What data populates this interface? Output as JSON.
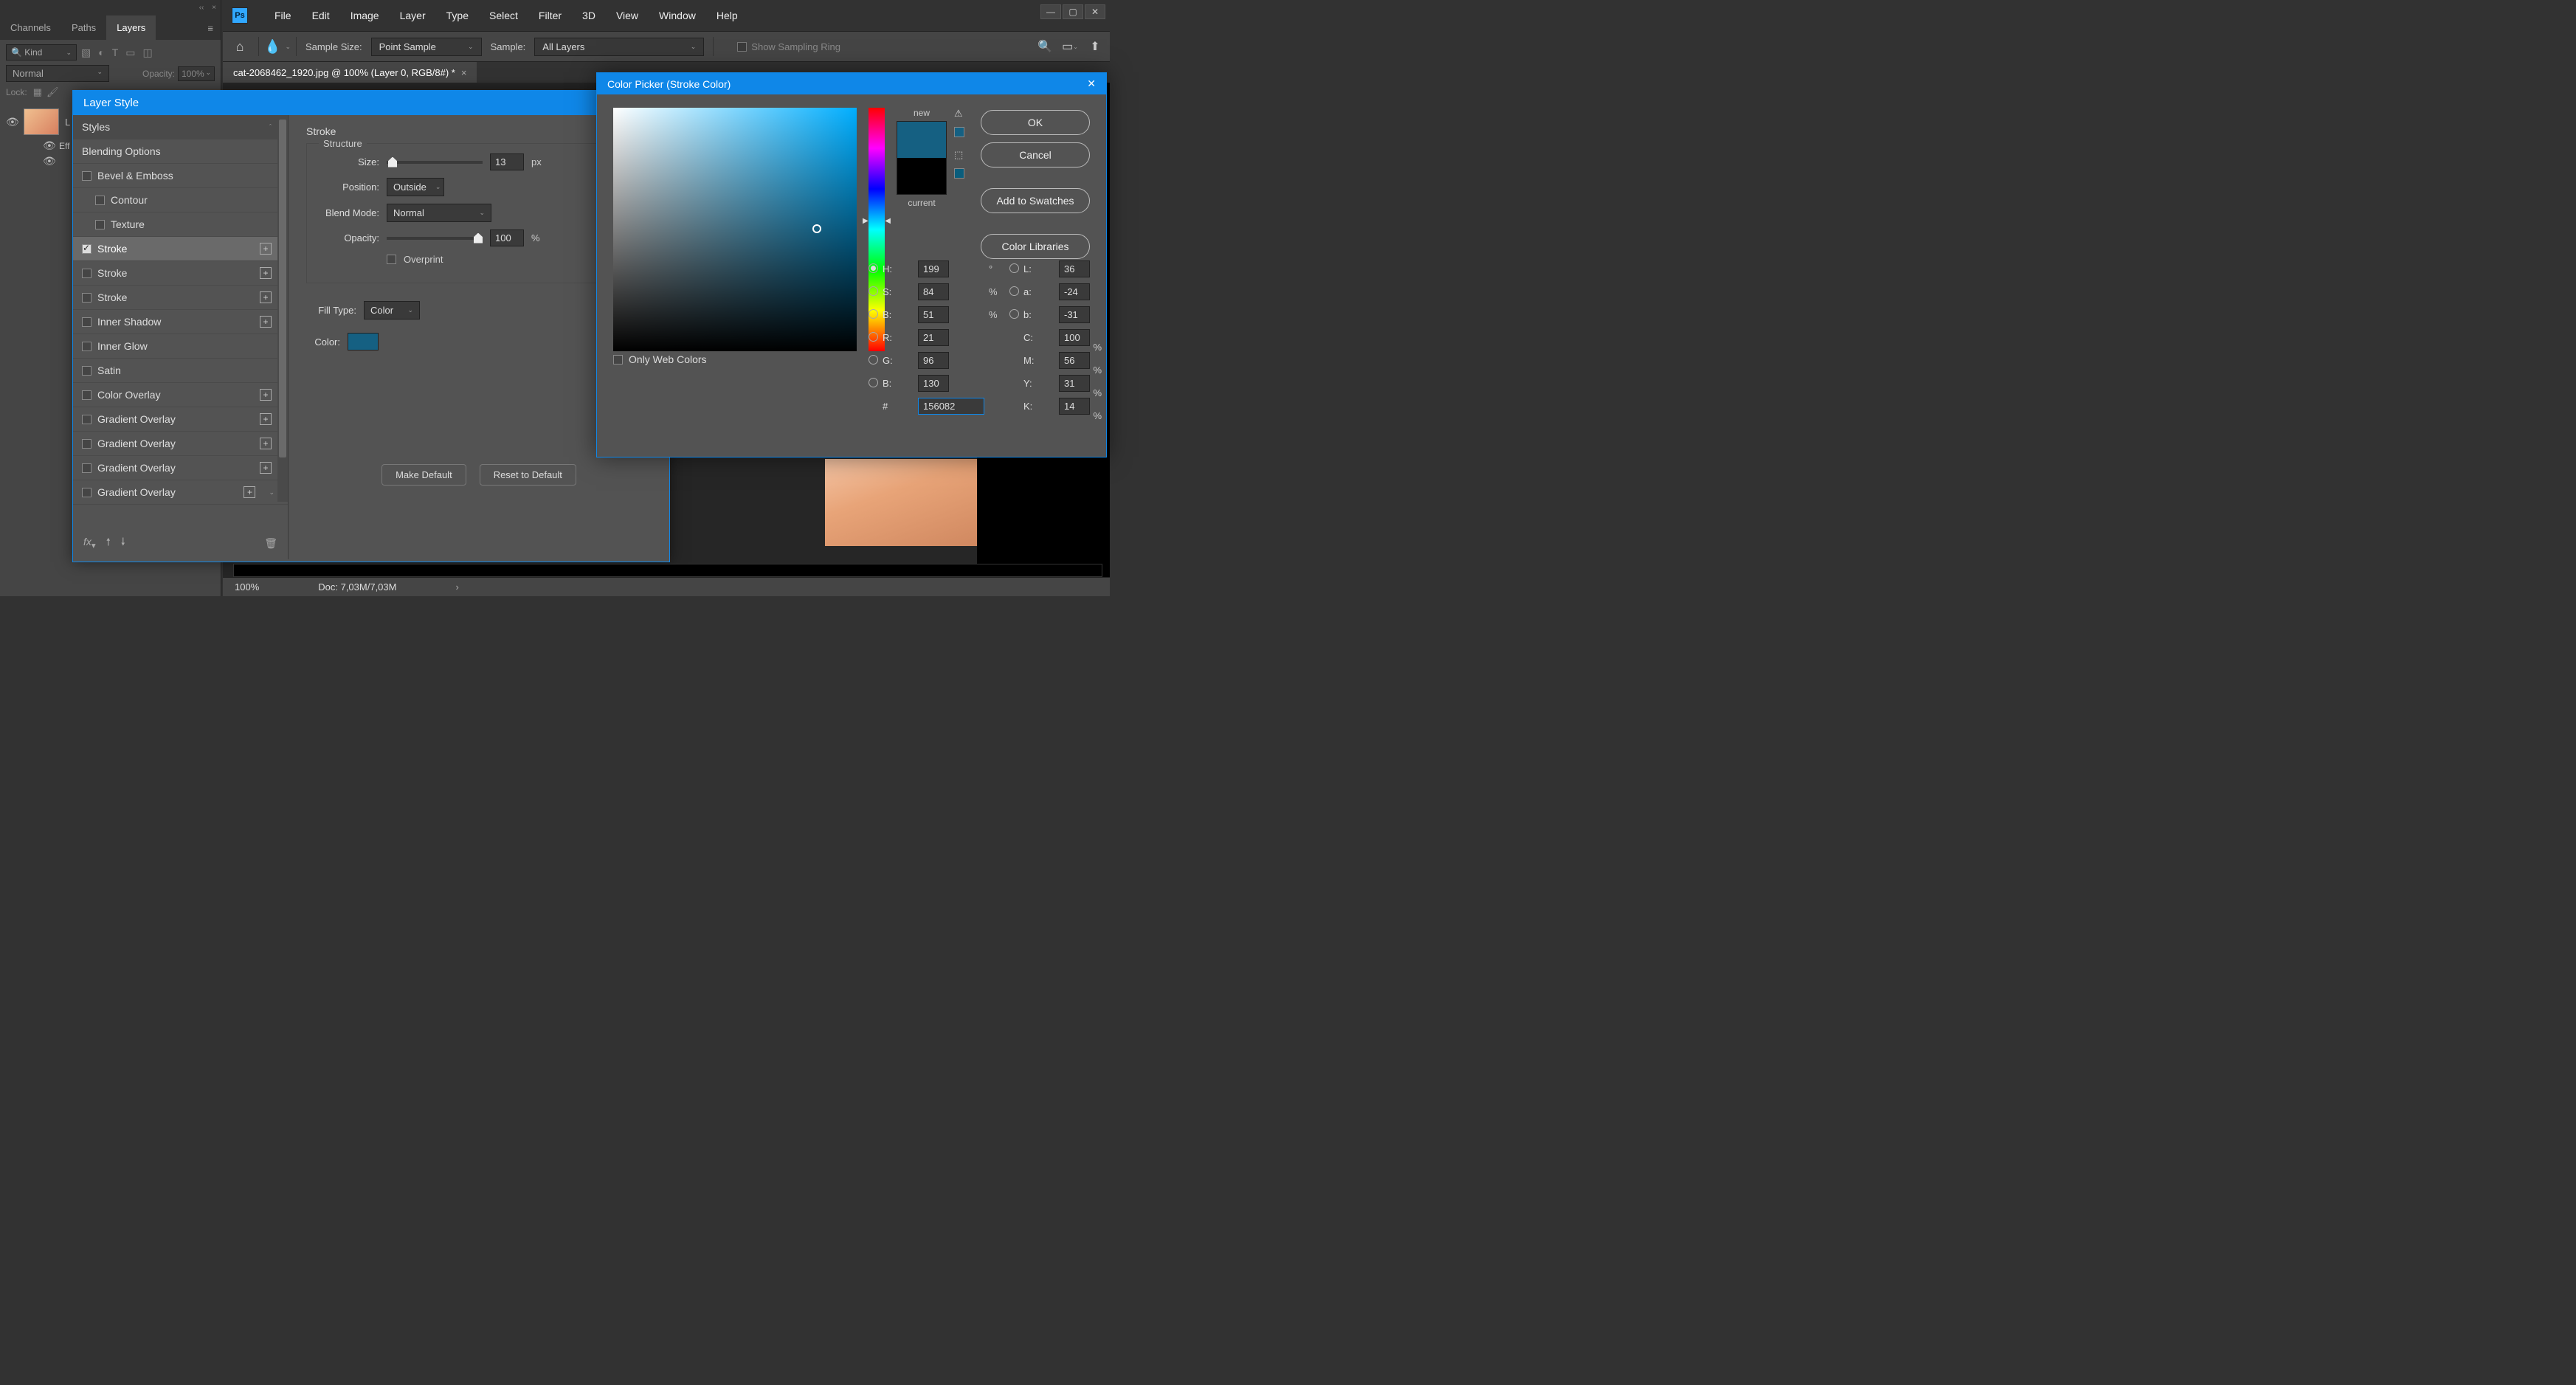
{
  "menu": {
    "items": [
      "File",
      "Edit",
      "Image",
      "Layer",
      "Type",
      "Select",
      "Filter",
      "3D",
      "View",
      "Window",
      "Help"
    ]
  },
  "optionsBar": {
    "sampleSizeLabel": "Sample Size:",
    "sampleSizeValue": "Point Sample",
    "sampleLabel": "Sample:",
    "sampleValue": "All Layers",
    "showSamplingRing": "Show Sampling Ring"
  },
  "docTab": {
    "title": "cat-2068462_1920.jpg @ 100% (Layer 0, RGB/8#) *"
  },
  "panels": {
    "tabs": [
      "Channels",
      "Paths",
      "Layers"
    ],
    "activeTab": "Layers",
    "kindLabel": "Kind",
    "blendMode": "Normal",
    "opacityLabel": "Opacity:",
    "opacityValue": "100%",
    "lockLabel": "Lock:",
    "layerName": "L",
    "effectsLabel": "Eff"
  },
  "layerStyle": {
    "title": "Layer Style",
    "items": [
      {
        "label": "Styles",
        "type": "header"
      },
      {
        "label": "Blending Options",
        "type": "row"
      },
      {
        "label": "Bevel & Emboss",
        "type": "check"
      },
      {
        "label": "Contour",
        "type": "check",
        "indent": true
      },
      {
        "label": "Texture",
        "type": "check",
        "indent": true
      },
      {
        "label": "Stroke",
        "type": "check",
        "checked": true,
        "selected": true,
        "plus": true
      },
      {
        "label": "Stroke",
        "type": "check",
        "plus": true
      },
      {
        "label": "Stroke",
        "type": "check",
        "plus": true
      },
      {
        "label": "Inner Shadow",
        "type": "check",
        "plus": true
      },
      {
        "label": "Inner Glow",
        "type": "check"
      },
      {
        "label": "Satin",
        "type": "check"
      },
      {
        "label": "Color Overlay",
        "type": "check",
        "plus": true
      },
      {
        "label": "Gradient Overlay",
        "type": "check",
        "plus": true
      },
      {
        "label": "Gradient Overlay",
        "type": "check",
        "plus": true
      },
      {
        "label": "Gradient Overlay",
        "type": "check",
        "plus": true
      },
      {
        "label": "Gradient Overlay",
        "type": "check",
        "plus": true
      }
    ],
    "section": "Stroke",
    "group1": "Structure",
    "sizeLabel": "Size:",
    "sizeValue": "13",
    "sizeUnit": "px",
    "posLabel": "Position:",
    "posValue": "Outside",
    "blendLabel": "Blend Mode:",
    "blendValue": "Normal",
    "opacityLabel": "Opacity:",
    "opacityValue": "100",
    "opacityUnit": "%",
    "overprintLabel": "Overprint",
    "fillTypeLabel": "Fill Type:",
    "fillTypeValue": "Color",
    "colorLabel": "Color:",
    "makeDefault": "Make Default",
    "resetDefault": "Reset to Default"
  },
  "colorPicker": {
    "title": "Color Picker (Stroke Color)",
    "newLabel": "new",
    "currentLabel": "current",
    "okBtn": "OK",
    "cancelBtn": "Cancel",
    "addSwatches": "Add to Swatches",
    "colorLibraries": "Color Libraries",
    "onlyWeb": "Only Web Colors",
    "fields": {
      "H": {
        "label": "H:",
        "val": "199",
        "unit": "°"
      },
      "S": {
        "label": "S:",
        "val": "84",
        "unit": "%"
      },
      "B": {
        "label": "B:",
        "val": "51",
        "unit": "%"
      },
      "R": {
        "label": "R:",
        "val": "21"
      },
      "G": {
        "label": "G:",
        "val": "96"
      },
      "Bc": {
        "label": "B:",
        "val": "130"
      },
      "L": {
        "label": "L:",
        "val": "36"
      },
      "a": {
        "label": "a:",
        "val": "-24"
      },
      "b": {
        "label": "b:",
        "val": "-31"
      },
      "C": {
        "label": "C:",
        "val": "100",
        "unit": "%"
      },
      "M": {
        "label": "M:",
        "val": "56",
        "unit": "%"
      },
      "Y": {
        "label": "Y:",
        "val": "31",
        "unit": "%"
      },
      "K": {
        "label": "K:",
        "val": "14",
        "unit": "%"
      },
      "hex": {
        "label": "#",
        "val": "156082"
      }
    },
    "newColor": "#156082",
    "currentColor": "#000000"
  },
  "statusBar": {
    "zoom": "100%",
    "doc": "Doc: 7,03M/7,03M"
  },
  "searchPrefix": "🔍"
}
